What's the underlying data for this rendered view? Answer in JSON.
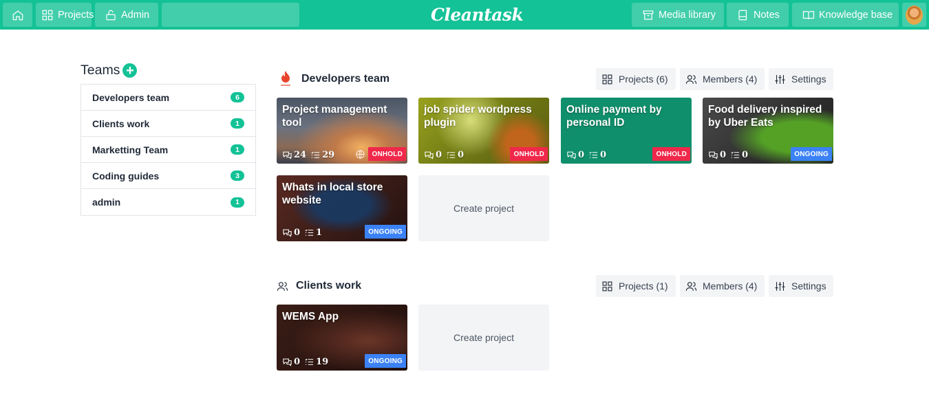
{
  "nav": {
    "home_label": "",
    "projects_label": "Projects",
    "admin_label": "Admin",
    "search_placeholder": "",
    "logo_text": "Cleantask",
    "media_label": "Media library",
    "notes_label": "Notes",
    "kb_label": "Knowledge base"
  },
  "sidebar": {
    "title": "Teams",
    "teams": [
      {
        "name": "Developers team",
        "count": "6"
      },
      {
        "name": "Clients work",
        "count": "1"
      },
      {
        "name": "Marketting Team",
        "count": "1"
      },
      {
        "name": "Coding guides",
        "count": "3"
      },
      {
        "name": "admin",
        "count": "1"
      }
    ]
  },
  "sections": [
    {
      "title": "Developers team",
      "projects_label": "Projects (6)",
      "members_label": "Members (4)",
      "settings_label": "Settings",
      "cards": [
        {
          "title": "Project management tool",
          "comments": "24",
          "tasks": "29",
          "status": "ONHOLD"
        },
        {
          "title": "job spider wordpress plugin",
          "comments": "0",
          "tasks": "0",
          "status": "ONHOLD"
        },
        {
          "title": "Online payment by personal ID",
          "comments": "0",
          "tasks": "0",
          "status": "ONHOLD"
        },
        {
          "title": "Food delivery inspired by Uber Eats",
          "comments": "0",
          "tasks": "0",
          "status": "ONGOING"
        },
        {
          "title": "Whats in local store website",
          "comments": "0",
          "tasks": "1",
          "status": "ONGOING"
        }
      ],
      "create_label": "Create project"
    },
    {
      "title": "Clients work",
      "projects_label": "Projects (1)",
      "members_label": "Members (4)",
      "settings_label": "Settings",
      "cards": [
        {
          "title": "WEMS App",
          "comments": "0",
          "tasks": "19",
          "status": "ONGOING"
        }
      ],
      "create_label": "Create project"
    }
  ],
  "colors": {
    "brand": "#13c296",
    "onhold": "#f0284a",
    "ongoing": "#3b82f6"
  }
}
